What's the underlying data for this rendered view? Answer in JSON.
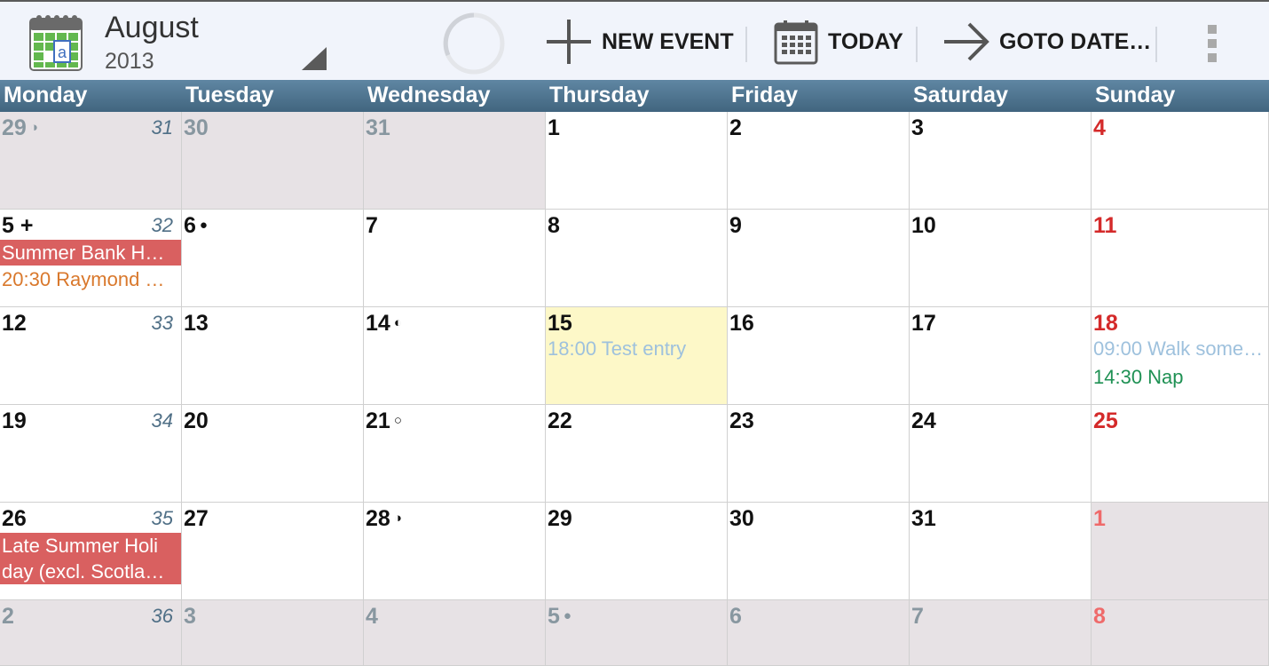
{
  "header": {
    "month": "August",
    "year": "2013",
    "new_event_label": "NEW EVENT",
    "today_label": "TODAY",
    "goto_label": "GOTO DATE…"
  },
  "icons": {
    "app": "calendar-app-icon",
    "dropdown": "dropdown-triangle-icon",
    "spinner": "loading-spinner-icon",
    "new_event": "plus-icon",
    "today": "calendar-grid-icon",
    "goto": "arrow-right-icon",
    "overflow": "overflow-menu-icon"
  },
  "colors": {
    "header_bar": "#4e7590",
    "other_month_bg": "#e7e2e5",
    "today_bg": "#fdf8c8",
    "holiday_bg": "#d96060",
    "sunday_text": "#d42a2a"
  },
  "weekdays": [
    "Monday",
    "Tuesday",
    "Wednesday",
    "Thursday",
    "Friday",
    "Saturday",
    "Sunday"
  ],
  "weeks": [
    {
      "week_no": "31",
      "days": [
        {
          "d": "29",
          "moon": "◑",
          "other": true
        },
        {
          "d": "30",
          "other": true
        },
        {
          "d": "31",
          "other": true
        },
        {
          "d": "1"
        },
        {
          "d": "2"
        },
        {
          "d": "3"
        },
        {
          "d": "4",
          "sun": true
        }
      ]
    },
    {
      "week_no": "32",
      "days": [
        {
          "d": "5",
          "suffix": " +",
          "holiday": [
            "Summer Bank H…"
          ],
          "events": [
            {
              "text": "20:30 Raymond …",
              "color": "#d9782c"
            }
          ]
        },
        {
          "d": "6",
          "moon": "●"
        },
        {
          "d": "7"
        },
        {
          "d": "8"
        },
        {
          "d": "9"
        },
        {
          "d": "10"
        },
        {
          "d": "11",
          "sun": true
        }
      ]
    },
    {
      "week_no": "33",
      "days": [
        {
          "d": "12"
        },
        {
          "d": "13"
        },
        {
          "d": "14",
          "moon": "◐"
        },
        {
          "d": "15",
          "today": true,
          "events": [
            {
              "text": "18:00 Test entry",
              "color": "#9ec1dd"
            }
          ]
        },
        {
          "d": "16"
        },
        {
          "d": "17"
        },
        {
          "d": "18",
          "sun": true,
          "events": [
            {
              "text": "09:00 Walk some…",
              "color": "#9ec1dd"
            },
            {
              "text": "14:30 Nap",
              "color": "#1f9154"
            }
          ]
        }
      ]
    },
    {
      "week_no": "34",
      "days": [
        {
          "d": "19"
        },
        {
          "d": "20"
        },
        {
          "d": "21",
          "moon": "○"
        },
        {
          "d": "22"
        },
        {
          "d": "23"
        },
        {
          "d": "24"
        },
        {
          "d": "25",
          "sun": true
        }
      ]
    },
    {
      "week_no": "35",
      "days": [
        {
          "d": "26",
          "holiday": [
            "Late Summer Holi",
            "day (excl. Scotla…"
          ]
        },
        {
          "d": "27"
        },
        {
          "d": "28",
          "moon": "◑"
        },
        {
          "d": "29"
        },
        {
          "d": "30"
        },
        {
          "d": "31"
        },
        {
          "d": "1",
          "sun": true,
          "other": true
        }
      ]
    },
    {
      "week_no": "36",
      "days": [
        {
          "d": "2",
          "other": true
        },
        {
          "d": "3",
          "other": true
        },
        {
          "d": "4",
          "other": true
        },
        {
          "d": "5",
          "moon": "●",
          "other": true
        },
        {
          "d": "6",
          "other": true
        },
        {
          "d": "7",
          "other": true
        },
        {
          "d": "8",
          "sun": true,
          "other": true
        }
      ]
    }
  ]
}
